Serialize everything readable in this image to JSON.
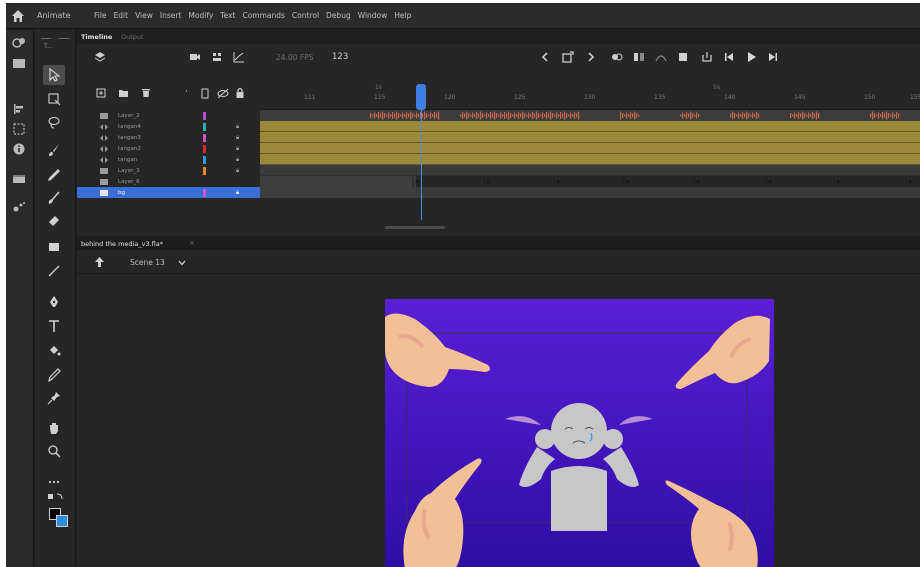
{
  "app": {
    "name": "Animate"
  },
  "menu": [
    "File",
    "Edit",
    "View",
    "Insert",
    "Modify",
    "Text",
    "Commands",
    "Control",
    "Debug",
    "Window",
    "Help"
  ],
  "timeline": {
    "tabs": [
      "Timeline",
      "Output"
    ],
    "fps": "24.00 FPS",
    "current_frame": "123",
    "ruler_marks": [
      {
        "label": "1s",
        "frame": 119
      },
      {
        "label": "5s",
        "frame": 145
      }
    ],
    "ruler_ticks": [
      "111",
      "115",
      "120",
      "125",
      "130",
      "135",
      "140",
      "145",
      "150",
      "155"
    ],
    "layers": [
      {
        "name": "Layer_2",
        "color": "#b44fd1",
        "type": "layer",
        "locked": false,
        "selected": false
      },
      {
        "name": "tangan4",
        "color": "#1fb8a8",
        "type": "motion",
        "locked": true,
        "selected": false
      },
      {
        "name": "tangan3",
        "color": "#d64fc6",
        "type": "motion",
        "locked": true,
        "selected": false
      },
      {
        "name": "tangan2",
        "color": "#e02a2a",
        "type": "motion",
        "locked": true,
        "selected": false
      },
      {
        "name": "tangan",
        "color": "#2f9ad6",
        "type": "motion",
        "locked": true,
        "selected": false
      },
      {
        "name": "Layer_3",
        "color": "#e8892a",
        "type": "layer",
        "locked": true,
        "selected": false
      },
      {
        "name": "Layer_6",
        "color": "#333333",
        "type": "layer",
        "locked": false,
        "selected": false
      },
      {
        "name": "bg",
        "color": "#d64fd6",
        "type": "layer",
        "locked": true,
        "selected": true
      }
    ]
  },
  "document": {
    "tab": "behind the media_v3.fla*"
  },
  "scene": {
    "name": "Scene 13"
  },
  "colors": {
    "accent": "#3d7fe3",
    "tween": "#9c8a3a",
    "audio": "#c8674a",
    "stage_top": "#5a1fd6",
    "stage_bottom": "#2d0ea6",
    "skin": "#f3bf96",
    "character": "#c7c7c7",
    "pigtail": "#b98cd6"
  }
}
